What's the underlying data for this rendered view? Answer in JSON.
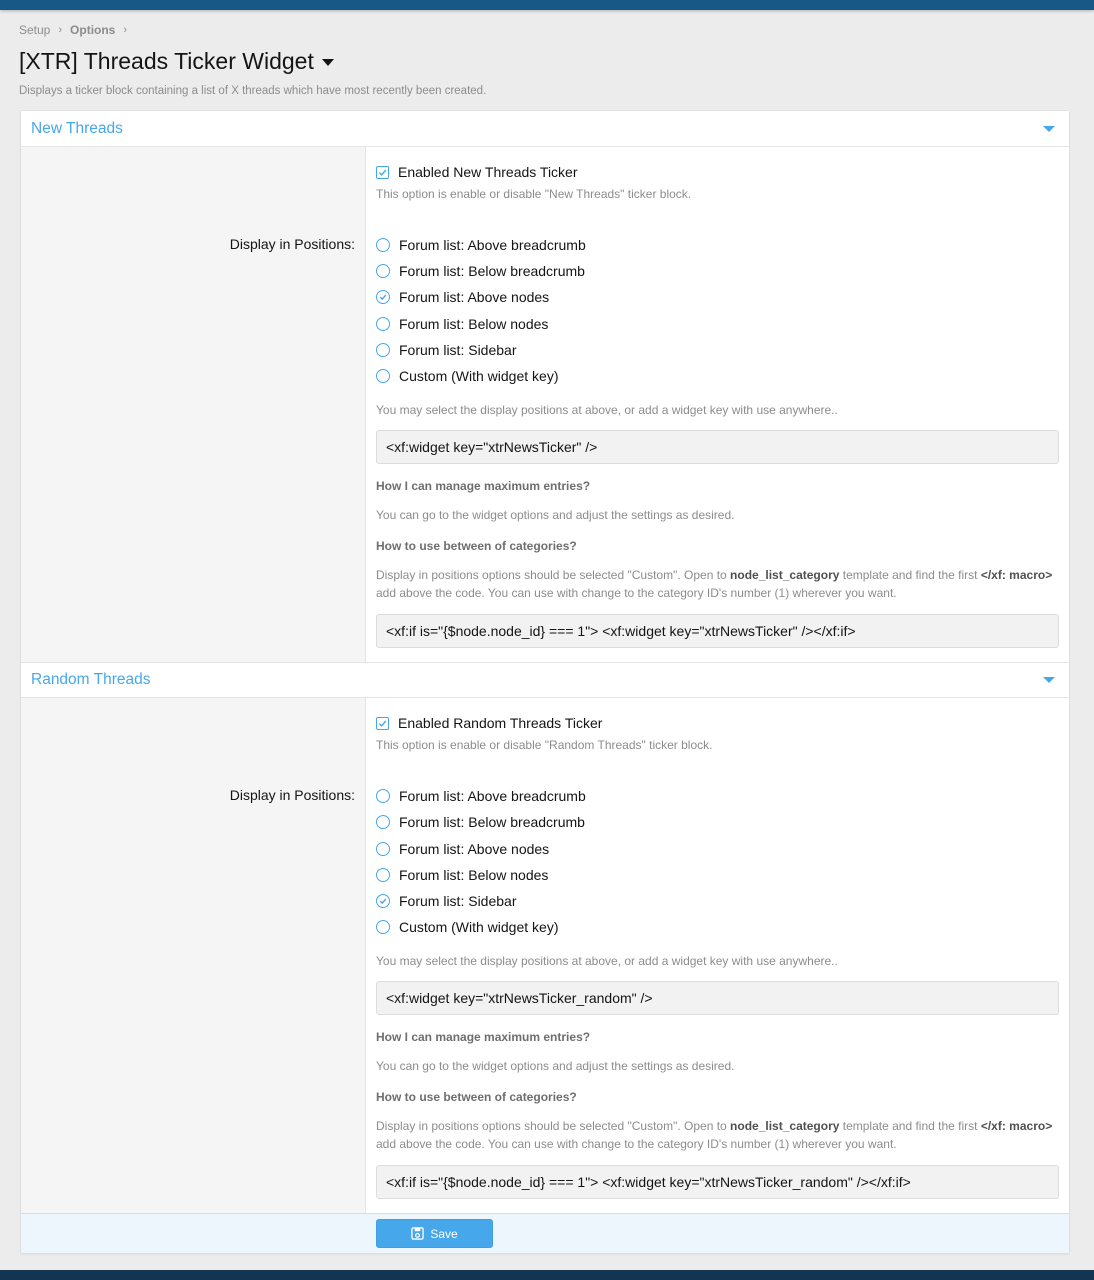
{
  "breadcrumb": {
    "items": [
      "Setup",
      "Options"
    ]
  },
  "page": {
    "title": "[XTR] Threads Ticker Widget",
    "description": "Displays a ticker block containing a list of X threads which have most recently been created."
  },
  "sections": [
    {
      "title": "New Threads",
      "enable_label": "Enabled New Threads Ticker",
      "enabled": true,
      "enable_hint": "This option is enable or disable \"New Threads\" ticker block.",
      "positions_label": "Display in Positions:",
      "positions": [
        {
          "label": "Forum list: Above breadcrumb",
          "selected": false
        },
        {
          "label": "Forum list: Below breadcrumb",
          "selected": false
        },
        {
          "label": "Forum list: Above nodes",
          "selected": true
        },
        {
          "label": "Forum list: Below nodes",
          "selected": false
        },
        {
          "label": "Forum list: Sidebar",
          "selected": false
        },
        {
          "label": "Custom (With widget key)",
          "selected": false
        }
      ],
      "positions_hint": "You may select the display positions at above, or add a widget key with use anywhere..",
      "widget_code": "<xf:widget key=\"xtrNewsTicker\" />",
      "faq1_q": "How I can manage maximum entries?",
      "faq1_a": "You can go to the widget options and adjust the settings as desired.",
      "faq2_q": "How to use between of categories?",
      "faq2_a_1": "Display in positions options should be selected \"Custom\". Open to ",
      "faq2_a_bold1": "node_list_category",
      "faq2_a_2": " template and find the first ",
      "faq2_a_bold2": "</xf: macro>",
      "faq2_a_3": " add above the code. You can use with change to the category ID's number (1) wherever you want.",
      "category_code": "<xf:if is=\"{$node.node_id} === 1\">  <xf:widget key=\"xtrNewsTicker\" /></xf:if>"
    },
    {
      "title": "Random Threads",
      "enable_label": "Enabled Random Threads Ticker",
      "enabled": true,
      "enable_hint": "This option is enable or disable \"Random Threads\" ticker block.",
      "positions_label": "Display in Positions:",
      "positions": [
        {
          "label": "Forum list: Above breadcrumb",
          "selected": false
        },
        {
          "label": "Forum list: Below breadcrumb",
          "selected": false
        },
        {
          "label": "Forum list: Above nodes",
          "selected": false
        },
        {
          "label": "Forum list: Below nodes",
          "selected": false
        },
        {
          "label": "Forum list: Sidebar",
          "selected": true
        },
        {
          "label": "Custom (With widget key)",
          "selected": false
        }
      ],
      "positions_hint": "You may select the display positions at above, or add a widget key with use anywhere..",
      "widget_code": "<xf:widget key=\"xtrNewsTicker_random\" />",
      "faq1_q": "How I can manage maximum entries?",
      "faq1_a": "You can go to the widget options and adjust the settings as desired.",
      "faq2_q": "How to use between of categories?",
      "faq2_a_1": "Display in positions options should be selected \"Custom\". Open to ",
      "faq2_a_bold1": "node_list_category",
      "faq2_a_2": " template and find the first ",
      "faq2_a_bold2": "</xf: macro>",
      "faq2_a_3": " add above the code. You can use with change to the category ID's number (1) wherever you want.",
      "category_code": "<xf:if is=\"{$node.node_id} === 1\">  <xf:widget key=\"xtrNewsTicker_random\" /></xf:if>"
    }
  ],
  "footer": {
    "save_label": "Save"
  },
  "colors": {
    "accent": "#47a7eb",
    "topbar": "#185886",
    "bottombar": "#143552"
  }
}
